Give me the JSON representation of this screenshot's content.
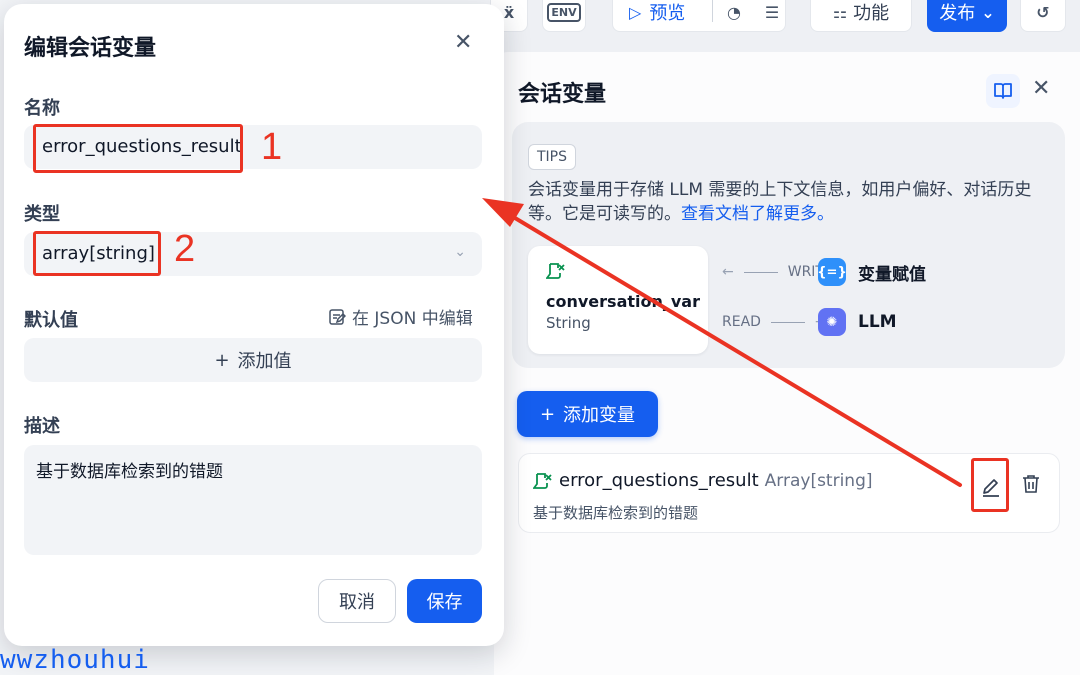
{
  "toolbar": {
    "variable_icon": "variable-icon",
    "env_label": "ENV",
    "preview_label": "预览",
    "history_icon": "history-icon",
    "checklist_icon": "checklist-icon",
    "features_label": "功能",
    "publish_label": "发布",
    "restore_icon": "restore-icon"
  },
  "panel": {
    "title": "会话变量",
    "tips_badge": "TIPS",
    "tips_text": "会话变量用于存储 LLM 需要的上下文信息，如用户偏好、对话历史等。它是可读写的。",
    "tips_link": "查看文档了解更多。",
    "example_var_name": "conversation_var",
    "example_var_type": "String",
    "write_label": "WRITE",
    "read_label": "READ",
    "write_node": "变量赋值",
    "read_node": "LLM",
    "add_variable_label": "添加变量",
    "variables": [
      {
        "name": "error_questions_result",
        "type": "Array[string]",
        "description": "基于数据库检索到的错题"
      }
    ]
  },
  "modal": {
    "title": "编辑会话变量",
    "name_label": "名称",
    "name_value": "error_questions_result",
    "type_label": "类型",
    "type_value": "array[string]",
    "default_label": "默认值",
    "json_edit_label": "在 JSON 中编辑",
    "add_value_label": "添加值",
    "desc_label": "描述",
    "desc_value": "基于数据库检索到的错题",
    "cancel_label": "取消",
    "save_label": "保存"
  },
  "annotations": {
    "label_1": "1",
    "label_2": "2",
    "color": "#ea3323"
  },
  "colors": {
    "primary": "#155eef",
    "annotation": "#ea3323"
  },
  "watermark": "wwzhouhui"
}
